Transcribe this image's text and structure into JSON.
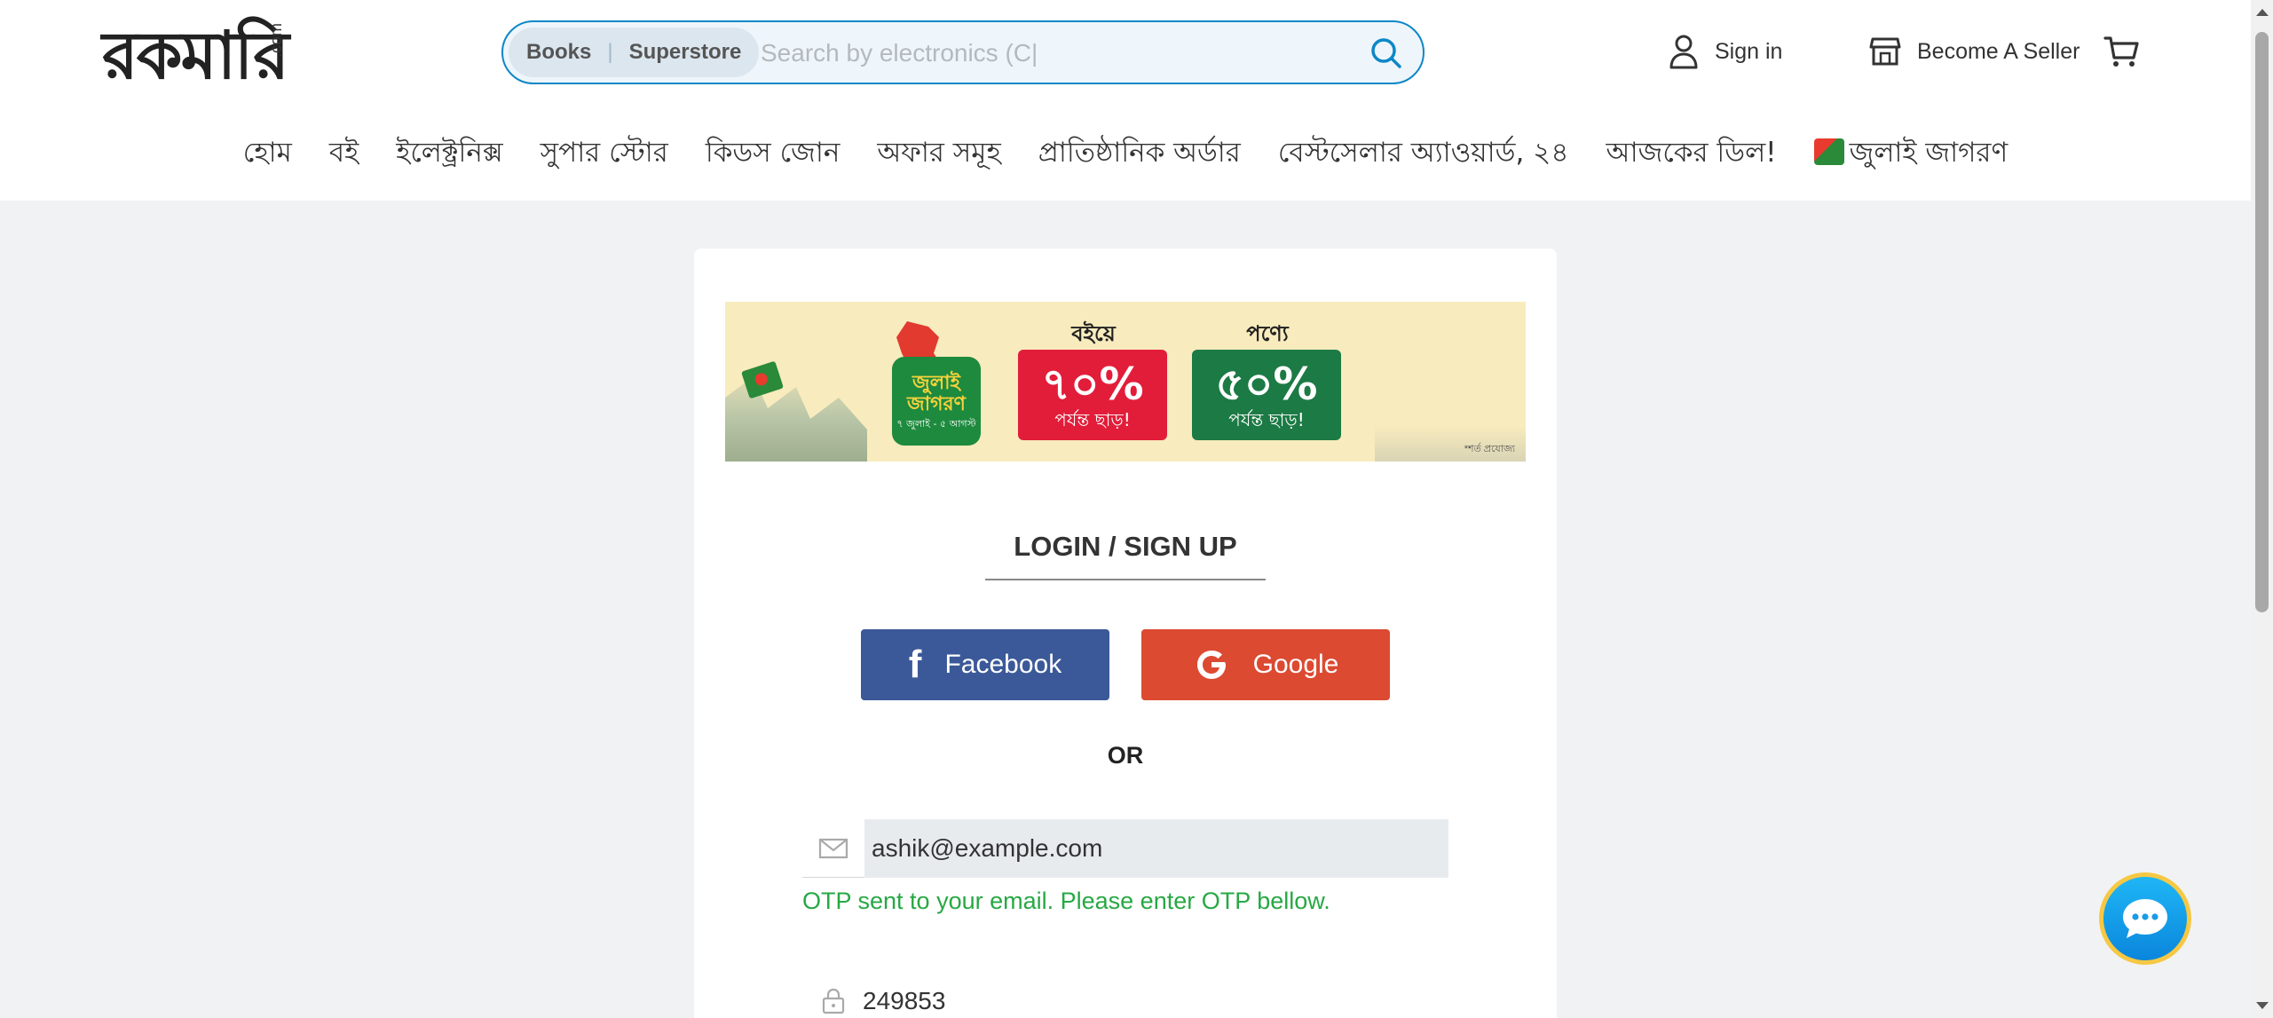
{
  "header": {
    "logo": {
      "main": "রকমারি",
      "suffix": ".com"
    },
    "search": {
      "category_books": "Books",
      "category_superstore": "Superstore",
      "placeholder": "Search by electronics (C|"
    },
    "sign_in": "Sign in",
    "become_seller": "Become A Seller",
    "cart_icon": "cart-icon"
  },
  "nav": {
    "items": [
      "হোম",
      "বই",
      "ইলেক্ট্রনিক্স",
      "সুপার স্টোর",
      "কিডস জোন",
      "অফার সমূহ",
      "প্রাতিষ্ঠানিক অর্ডার",
      "বেস্টসেলার অ্যাওয়ার্ড, ২৪",
      "আজকের ডিল!",
      "জুলাই জাগরণ"
    ]
  },
  "banner": {
    "logo_text": "জুলাই জাগরণ",
    "logo_sub": "৭ জুলাই - ৫ আগস্ট",
    "offer1_label": "বইয়ে",
    "offer1_pct": "৭০%",
    "offer1_sub": "পর্যন্ত ছাড়!",
    "offer2_label": "পণ্যে",
    "offer2_pct": "৫০%",
    "offer2_sub": "পর্যন্ত ছাড়!",
    "note": "*শর্ত প্রযোজ্য"
  },
  "login": {
    "title": "LOGIN / SIGN UP",
    "facebook": "Facebook",
    "google": "Google",
    "or": "OR",
    "email_value": "ashik@example.com",
    "otp_message": "OTP sent to your email. Please enter OTP bellow.",
    "otp_value": "249853"
  },
  "colors": {
    "accent": "#0d87c7",
    "facebook": "#3b5998",
    "google": "#dc4a32",
    "success": "#27a844"
  }
}
